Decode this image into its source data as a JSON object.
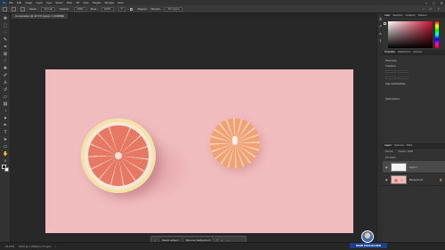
{
  "app": {
    "logo": "Ps"
  },
  "menu": [
    "File",
    "Edit",
    "Image",
    "Layer",
    "Type",
    "Select",
    "Filter",
    "3D",
    "View",
    "Plugins",
    "Window",
    "Help"
  ],
  "window_controls": [
    "−",
    "□",
    "✕"
  ],
  "options": {
    "mode_label": "Mode:",
    "mode_value": "Normal",
    "opacity_label": "Opacity:",
    "opacity_value": "100%",
    "flow_label": "Flow:",
    "flow_value": "100%",
    "angle_value": "0°",
    "aligned_label": "Aligned",
    "sample_label": "Sample:",
    "sample_value": "All Layers"
  },
  "document_tab": "Composition @ 16.7% (Layer 1, RGB/8#)",
  "context_bar": {
    "select_subject": "Select subject",
    "remove_bg": "Remove background"
  },
  "status": {
    "zoom": "16.67%",
    "size": "5472 px x 3648 px (72 ppi)"
  },
  "panels": {
    "color_tabs": [
      "Color",
      "Swatches",
      "Gradients",
      "Patterns"
    ],
    "props_tabs": [
      "Properties",
      "Adjustments",
      "Libraries"
    ],
    "props_title": "Pixel Layer",
    "transform_label": "Transform",
    "align_label": "Align and Distribute",
    "quick_actions": "Quick Actions",
    "layers_tabs": [
      "Layers",
      "Channels",
      "Paths"
    ],
    "blend_mode": "Normal",
    "opacity": "Opacity: 100%",
    "fill": "Fill: 100%",
    "layers": [
      {
        "name": "Layer 1",
        "selected": true
      },
      {
        "name": "Background",
        "selected": false
      }
    ]
  },
  "watermark": "RENÉ PRANSCHEN",
  "colors": {
    "canvas": "#f1bcbe",
    "accent": "#31a8ff"
  }
}
